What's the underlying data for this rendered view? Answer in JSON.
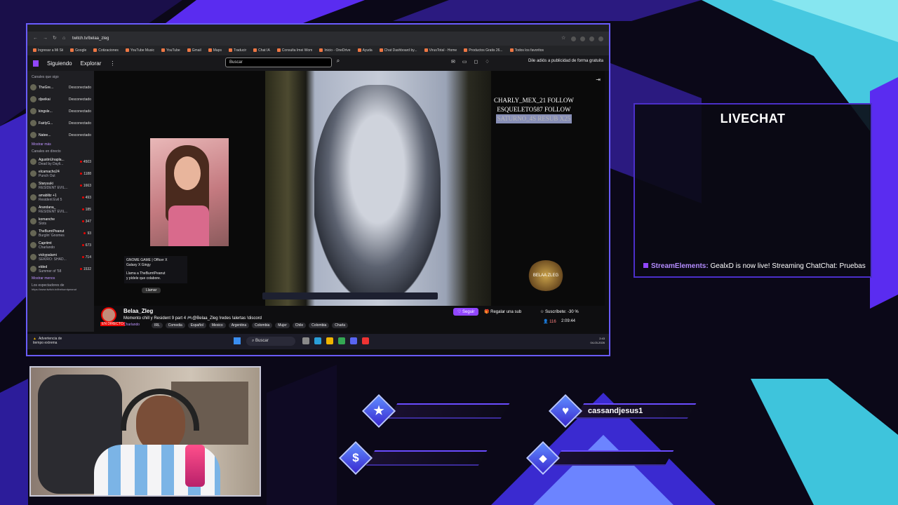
{
  "browser": {
    "url": "twitch.tv/belaa_zleg",
    "bookmarks": [
      "Ingresar a Mi Sii",
      "Google",
      "Cotizaciones",
      "YouTube Music",
      "YouTube",
      "Gmail",
      "Maps",
      "Traducir",
      "Chat IA",
      "Consulta Imei Wom",
      "Inicio - OneDrive",
      "Ayuda",
      "Chat Dashboard by...",
      "VirusTotal - Home",
      "Productos Gratis 26...",
      "Todos los favoritos"
    ]
  },
  "twitch": {
    "nav_following": "Siguiendo",
    "nav_browse": "Explorar",
    "search_placeholder": "Buscar",
    "ad_free": "Dile adiós a publicidad de forma gratuita"
  },
  "sidebar": {
    "header_followed": "Canales que sigo",
    "offline": [
      {
        "name": "TheGre...",
        "status": "Desconectado"
      },
      {
        "name": "djseikai",
        "status": "Desconectado"
      },
      {
        "name": "kingsle...",
        "status": "Desconectado"
      },
      {
        "name": "FairlyG...",
        "status": "Desconectado"
      },
      {
        "name": "Natee...",
        "status": "Desconectado"
      }
    ],
    "show_more_1": "Mostrar más",
    "header_live": "Canales en directo",
    "live": [
      {
        "name": "AgustinUnapla...",
        "game": "Dead by Dayli...",
        "viewers": "4503"
      },
      {
        "name": "elcamacho24",
        "game": "Punch Out",
        "viewers": "1188"
      },
      {
        "name": "Staryuuki",
        "game": "RESIDENT EVIL...",
        "viewers": "1663"
      },
      {
        "name": "amablitz +1",
        "game": "Resident Evil 5",
        "viewers": "493"
      },
      {
        "name": "Arandana_",
        "game": "RESIDENT EVIL...",
        "viewers": "185"
      },
      {
        "name": "komanche",
        "game": "Slots",
        "viewers": "347"
      },
      {
        "name": "TheBurntPeanut",
        "game": "Burglin' Gnomes",
        "viewers": "93"
      },
      {
        "name": "Capriimt",
        "game": "Charlando",
        "viewers": "673"
      },
      {
        "name": "vickypalami",
        "game": "SEKIRO: SHAD...",
        "viewers": "714"
      },
      {
        "name": "elded",
        "game": "Summer of '58",
        "viewers": "1532"
      }
    ],
    "show_more_2": "Mostrar menos",
    "header_viewers": "Los espectadores de",
    "viewer_link": "https://www.twitch.tv/theburntpeanut"
  },
  "video": {
    "follows": [
      "CHARLY_MEX_21 FOLLOW",
      "ESQUELETO587 FOLLOW",
      "SATURNO_4S RESUB X25"
    ],
    "tooltip_line1": "GNOME GAME | Officer X",
    "tooltip_line2": "Galaxy X Gingy",
    "tooltip_line3": "Llama a TheBurntPeanut",
    "tooltip_line4": "y pídele que colabore.",
    "call_button": "Llamar",
    "badge_text": "BELAA ZLEG"
  },
  "stream_info": {
    "streamer": "Belaa_Zleg",
    "title": "Momento chill y Resident 9 part 4 🎮@Belaa_Zleg !redes !alertas !discord",
    "live_label": "EN DIRECTO",
    "category": "Charlando",
    "tags": [
      "IRL",
      "Comedia",
      "Español",
      "Mexico",
      "Argentina",
      "Colombia",
      "Mujer",
      "Chile",
      "Colombia",
      "Charla"
    ],
    "follow_btn": "Seguir",
    "gift_btn": "Regalar una sub",
    "sub_btn": "Suscríbete: -30 %",
    "viewers": "116",
    "uptime": "2:09:44"
  },
  "windows": {
    "warning_line1": "Advertencia de",
    "warning_line2": "tiempo extrema",
    "search": "Buscar",
    "clock_time": "2:43",
    "clock_date": "04-03-2026"
  },
  "livechat": {
    "title": "LIVECHAT",
    "message_user": "StreamElements:",
    "message_text": " GealxD is now live! Streaming ChatChat: Pruebas"
  },
  "alerts": {
    "follower_label": "",
    "sub_label": "cassandjesus1",
    "donation_label": "",
    "cheer_label": ""
  },
  "colors": {
    "accent": "#9146ff",
    "frame": "#6a5cff",
    "cyan": "#46d2e6"
  }
}
